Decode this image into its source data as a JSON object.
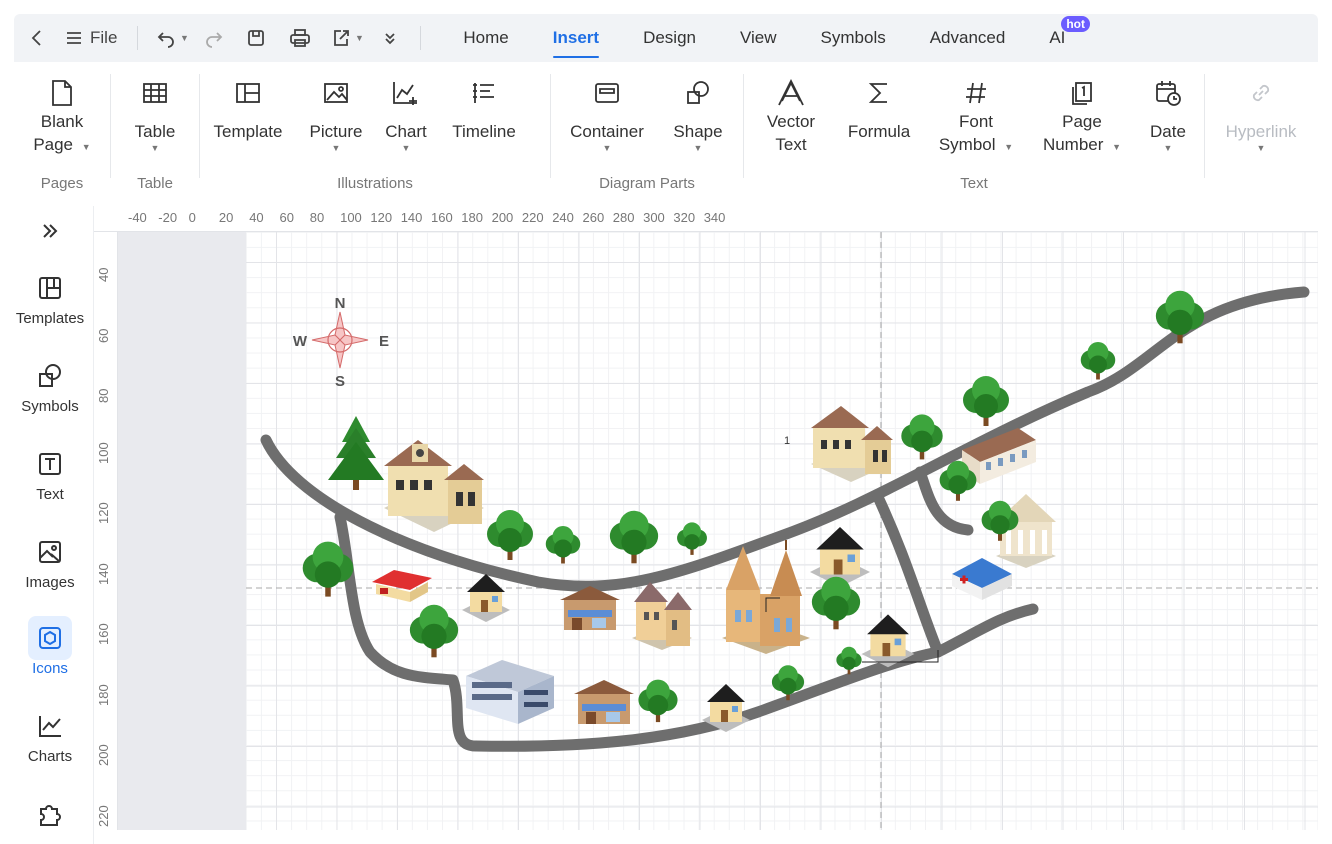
{
  "toolbar": {
    "file_label": "File"
  },
  "tabs": [
    {
      "label": "Home"
    },
    {
      "label": "Insert"
    },
    {
      "label": "Design"
    },
    {
      "label": "View"
    },
    {
      "label": "Symbols"
    },
    {
      "label": "Advanced"
    },
    {
      "label": "AI",
      "badge": "hot"
    }
  ],
  "active_tab": "Insert",
  "ribbon": {
    "pages": {
      "label": "Pages",
      "blank_page": [
        "Blank",
        "Page"
      ]
    },
    "table": {
      "label": "Table",
      "table_btn": "Table"
    },
    "illustrations": {
      "label": "Illustrations",
      "template": "Template",
      "picture": "Picture",
      "chart": "Chart",
      "timeline": "Timeline"
    },
    "diagram_parts": {
      "label": "Diagram Parts",
      "container": "Container",
      "shape": "Shape"
    },
    "text": {
      "label": "Text",
      "vector_text": [
        "Vector",
        "Text"
      ],
      "formula": "Formula",
      "font_symbol": [
        "Font",
        "Symbol"
      ],
      "page_number": [
        "Page",
        "Number"
      ],
      "date": "Date"
    },
    "hyperlink": "Hyperlink"
  },
  "sidebar": [
    {
      "label": "Templates"
    },
    {
      "label": "Symbols"
    },
    {
      "label": "Text"
    },
    {
      "label": "Images"
    },
    {
      "label": "Icons"
    },
    {
      "label": "Charts"
    }
  ],
  "active_sidebar": "Icons",
  "ruler_top": [
    "-40",
    "-20",
    "0",
    "20",
    "40",
    "60",
    "80",
    "100",
    "120",
    "140",
    "160",
    "180",
    "200",
    "220",
    "240",
    "260",
    "280",
    "300",
    "320",
    "340"
  ],
  "ruler_left": [
    "40",
    "60",
    "80",
    "100",
    "120",
    "140",
    "160",
    "180",
    "200",
    "220"
  ],
  "compass": {
    "n": "N",
    "s": "S",
    "e": "E",
    "w": "W"
  },
  "marker_label": "1",
  "colors": {
    "accent": "#1f6fe5",
    "road": "#6e6e6e",
    "tree": "#2e8b2e",
    "badge": "#6b5cff"
  }
}
